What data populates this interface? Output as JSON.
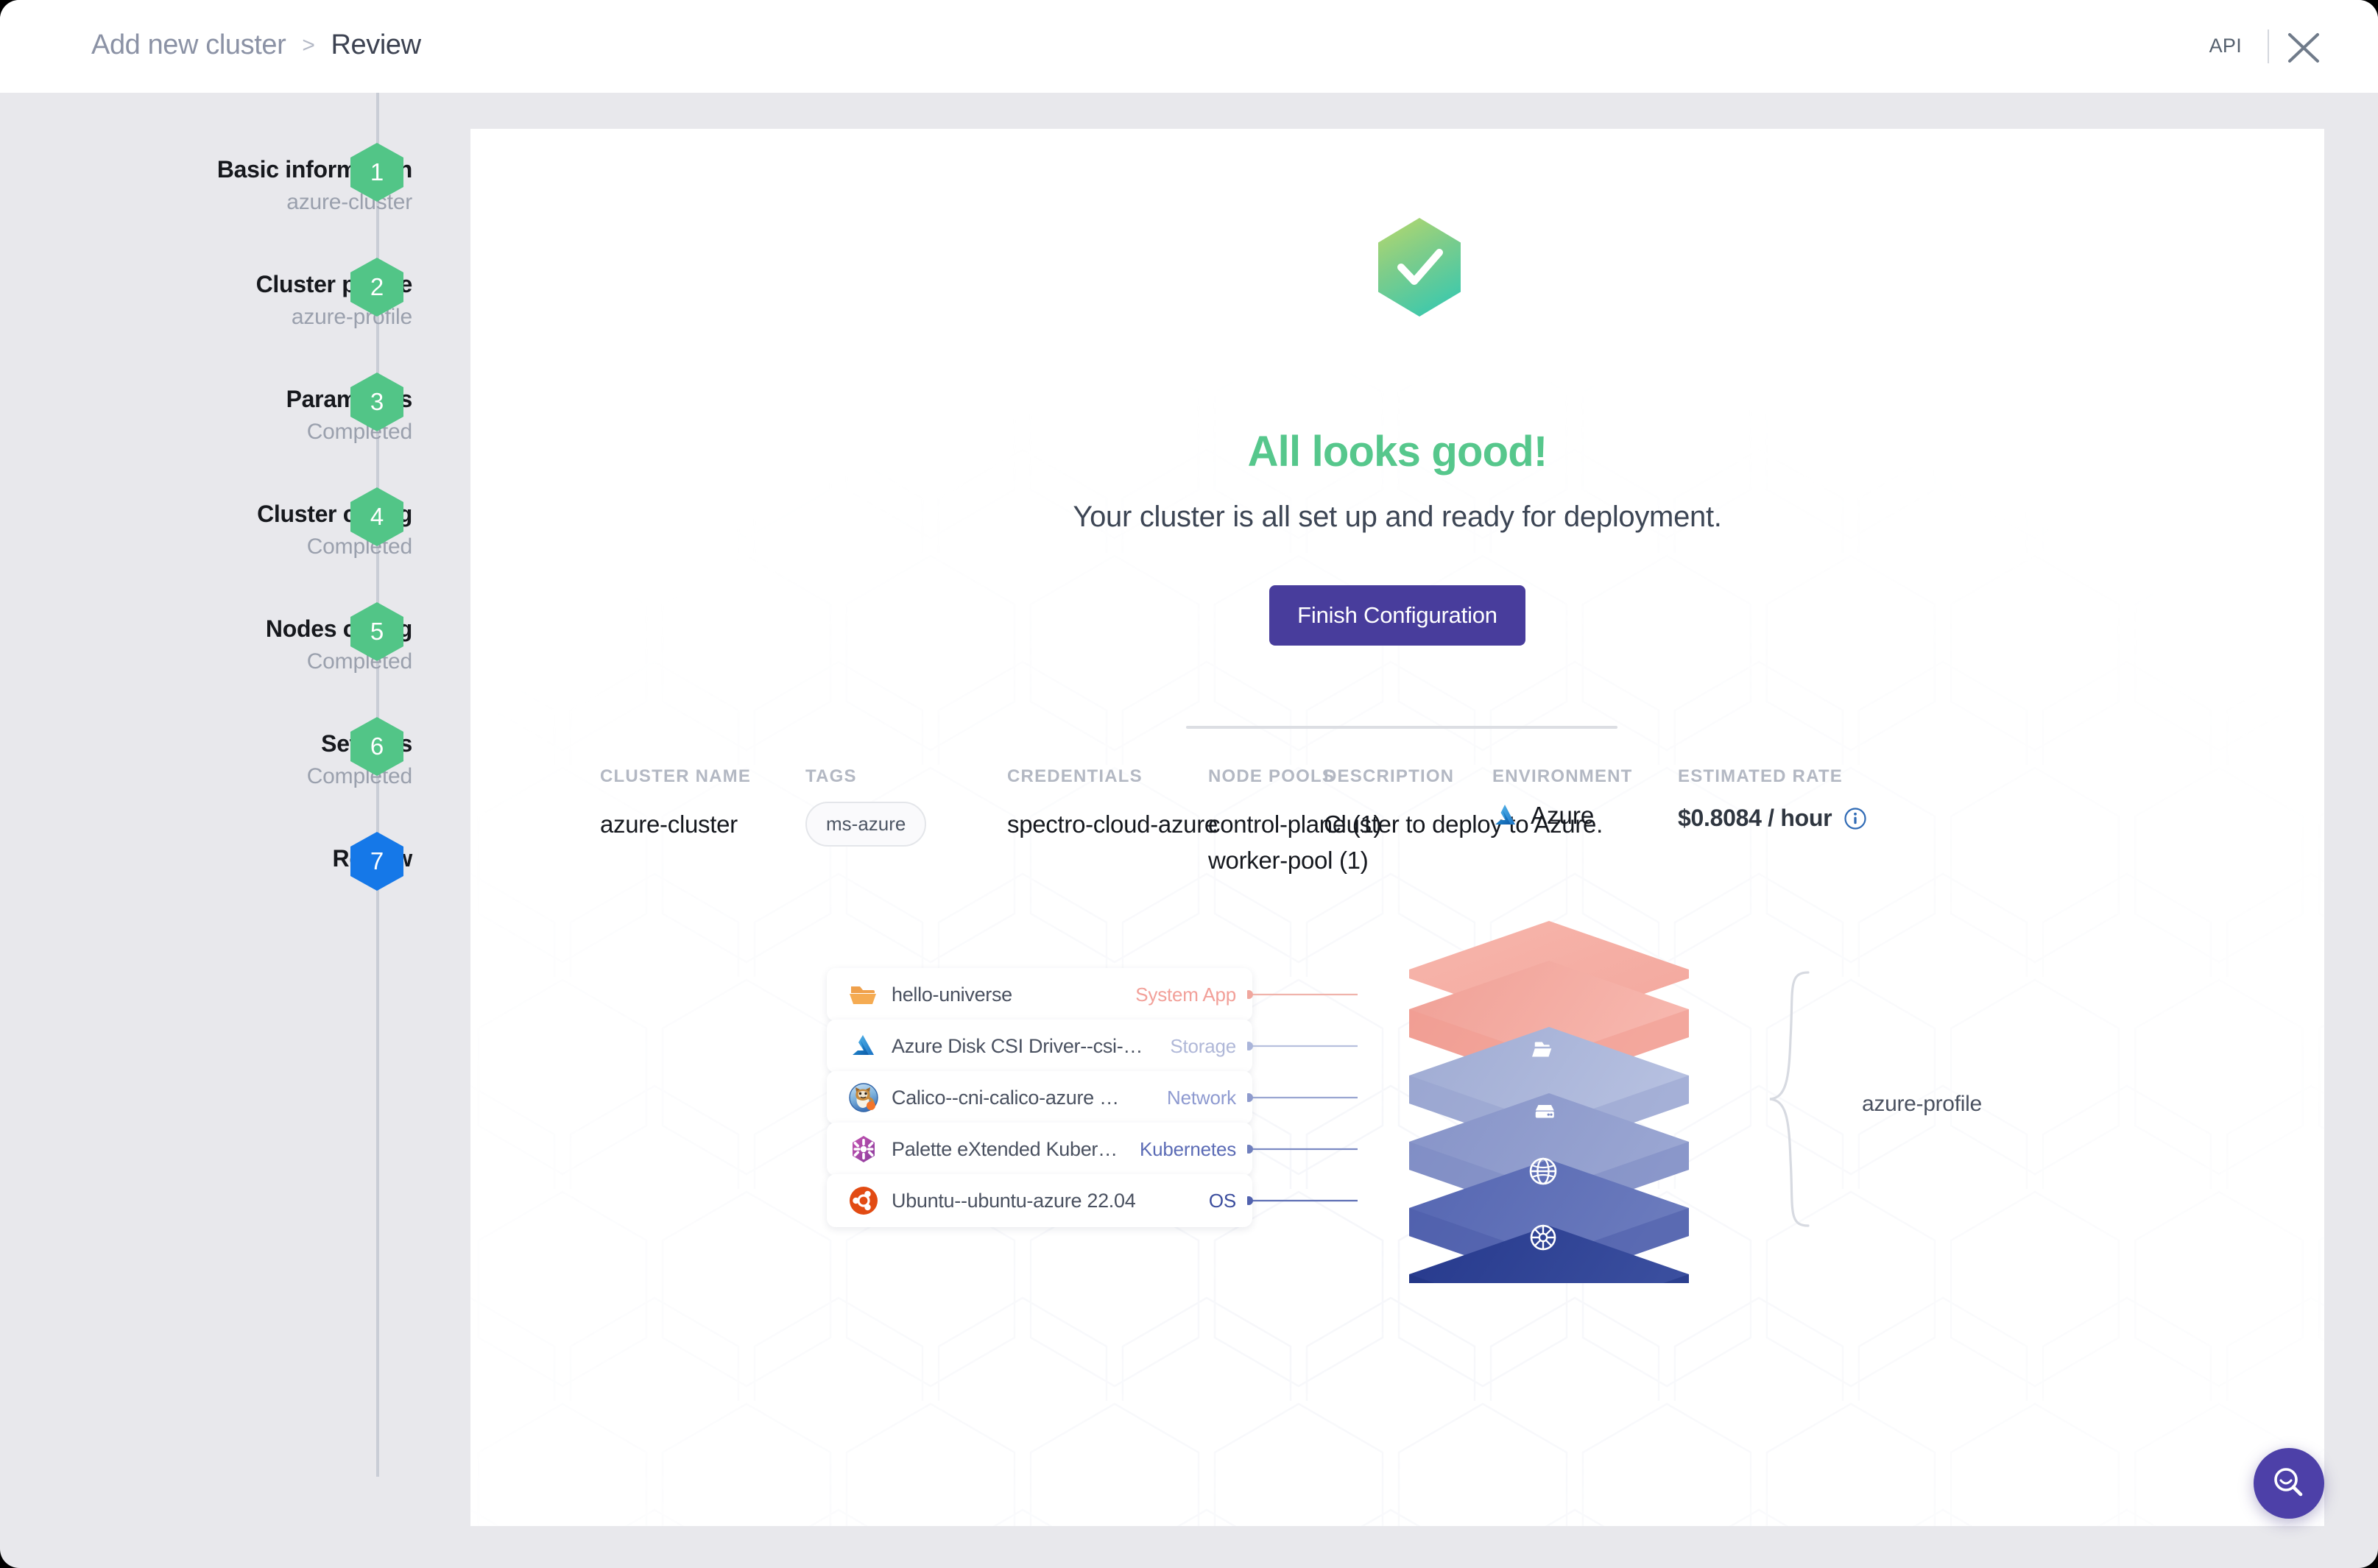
{
  "header": {
    "breadcrumb_parent": "Add new cluster",
    "breadcrumb_separator": ">",
    "breadcrumb_current": "Review",
    "api_label": "API",
    "close_icon": "close-icon"
  },
  "stepper": {
    "steps": [
      {
        "num": "1",
        "title": "Basic information",
        "sub": "azure-cluster",
        "state": "done"
      },
      {
        "num": "2",
        "title": "Cluster profile",
        "sub": "azure-profile",
        "state": "done"
      },
      {
        "num": "3",
        "title": "Parameters",
        "sub": "Completed",
        "state": "done"
      },
      {
        "num": "4",
        "title": "Cluster config",
        "sub": "Completed",
        "state": "done"
      },
      {
        "num": "5",
        "title": "Nodes config",
        "sub": "Completed",
        "state": "done"
      },
      {
        "num": "6",
        "title": "Settings",
        "sub": "Completed",
        "state": "done"
      },
      {
        "num": "7",
        "title": "Review",
        "sub": "",
        "state": "active"
      }
    ],
    "done_color": "#52c587",
    "active_color": "#1578e8"
  },
  "hero": {
    "icon": "check-hexagon-icon",
    "title": "All looks good!",
    "subtitle": "Your cluster is all set up and ready for deployment.",
    "button_label": "Finish Configuration",
    "title_color": "#56c78c",
    "button_color": "#483d9c"
  },
  "summary": {
    "cluster_name": {
      "label": "CLUSTER NAME",
      "value": "azure-cluster"
    },
    "tags": {
      "label": "TAGS",
      "values": [
        "ms-azure"
      ]
    },
    "credentials": {
      "label": "CREDENTIALS",
      "value": "spectro-cloud-azure"
    },
    "node_pools": {
      "label": "NODE POOLS",
      "values": [
        "control-plane (1)",
        "worker-pool (1)"
      ]
    },
    "description": {
      "label": "DESCRIPTION",
      "value": "Cluster to deploy to Azure."
    },
    "environment": {
      "label": "ENVIRONMENT",
      "value": "Azure",
      "icon": "azure-icon"
    },
    "estimated_rate": {
      "label": "ESTIMATED RATE",
      "value": "$0.8084 / hour",
      "info_icon": "info-icon"
    }
  },
  "profile": {
    "name": "azure-profile",
    "layers": [
      {
        "icon": "folder-icon",
        "name": "hello-universe",
        "type": "System App",
        "type_color": "#f2a099",
        "stack_color": "#f3a79d"
      },
      {
        "icon": "azure-icon",
        "name": "Azure Disk CSI Driver--csi-…",
        "type": "Storage",
        "type_color": "#b0b8d8",
        "stack_color": "#a8b3d8"
      },
      {
        "icon": "calico-icon",
        "name": "Calico--cni-calico-azure …",
        "type": "Network",
        "type_color": "#8e9ad0",
        "stack_color": "#8a97ca"
      },
      {
        "icon": "palette-icon",
        "name": "Palette eXtended Kuber…",
        "type": "Kubernetes",
        "type_color": "#5b6bb5",
        "stack_color": "#5a6ab4"
      },
      {
        "icon": "ubuntu-icon",
        "name": "Ubuntu--ubuntu-azure 22.04",
        "type": "OS",
        "type_color": "#3c4e9e",
        "stack_color": "#2b3f8f"
      }
    ]
  },
  "fab": {
    "icon": "search-icon",
    "color": "#4d40a8"
  }
}
